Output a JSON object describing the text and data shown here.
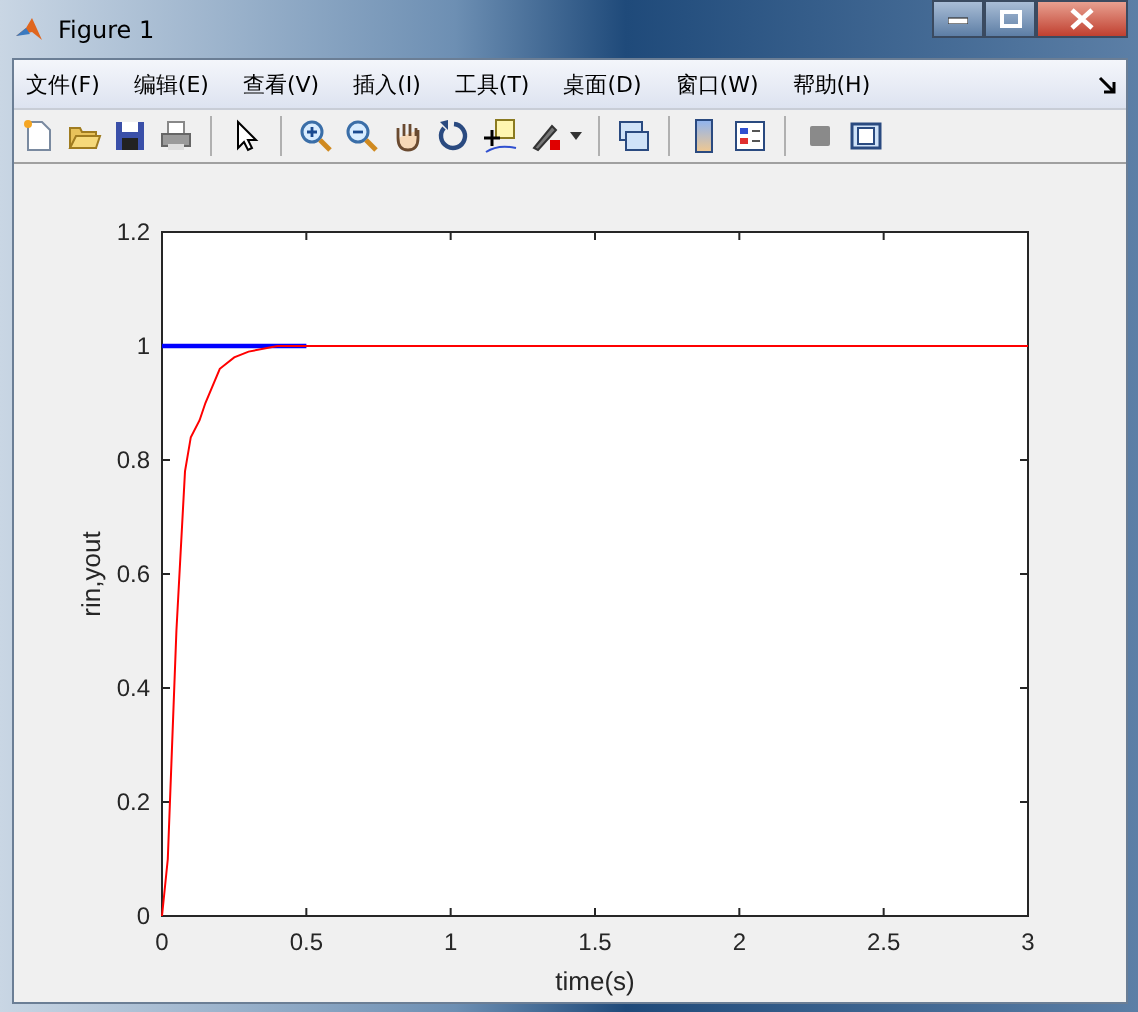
{
  "window": {
    "title": "Figure 1"
  },
  "menu": [
    {
      "label": "文件(F)"
    },
    {
      "label": "编辑(E)"
    },
    {
      "label": "查看(V)"
    },
    {
      "label": "插入(I)"
    },
    {
      "label": "工具(T)"
    },
    {
      "label": "桌面(D)"
    },
    {
      "label": "窗口(W)"
    },
    {
      "label": "帮助(H)"
    }
  ],
  "plot": {
    "chart_data": {
      "type": "line",
      "xlabel": "time(s)",
      "ylabel": "rin,yout",
      "x": [
        0,
        0.02,
        0.05,
        0.08,
        0.1,
        0.13,
        0.15,
        0.2,
        0.25,
        0.3,
        0.4,
        0.5,
        1,
        1.5,
        2,
        2.5,
        3
      ],
      "xlim": [
        0,
        3
      ],
      "ylim": [
        0,
        1.2
      ],
      "xticks": [
        0,
        0.5,
        1,
        1.5,
        2,
        2.5,
        3
      ],
      "yticks": [
        0,
        0.2,
        0.4,
        0.6,
        0.8,
        1,
        1.2
      ],
      "series": [
        {
          "color": "#0000ff",
          "values": [
            1,
            1,
            1,
            1,
            1,
            1,
            1,
            1,
            1,
            1,
            1,
            1,
            null,
            null,
            null,
            null,
            null
          ]
        },
        {
          "color": "#ff0000",
          "values": [
            0,
            0.1,
            0.5,
            0.78,
            0.84,
            0.87,
            0.9,
            0.96,
            0.98,
            0.99,
            1,
            1,
            1,
            1,
            1,
            1,
            1
          ]
        }
      ]
    }
  }
}
